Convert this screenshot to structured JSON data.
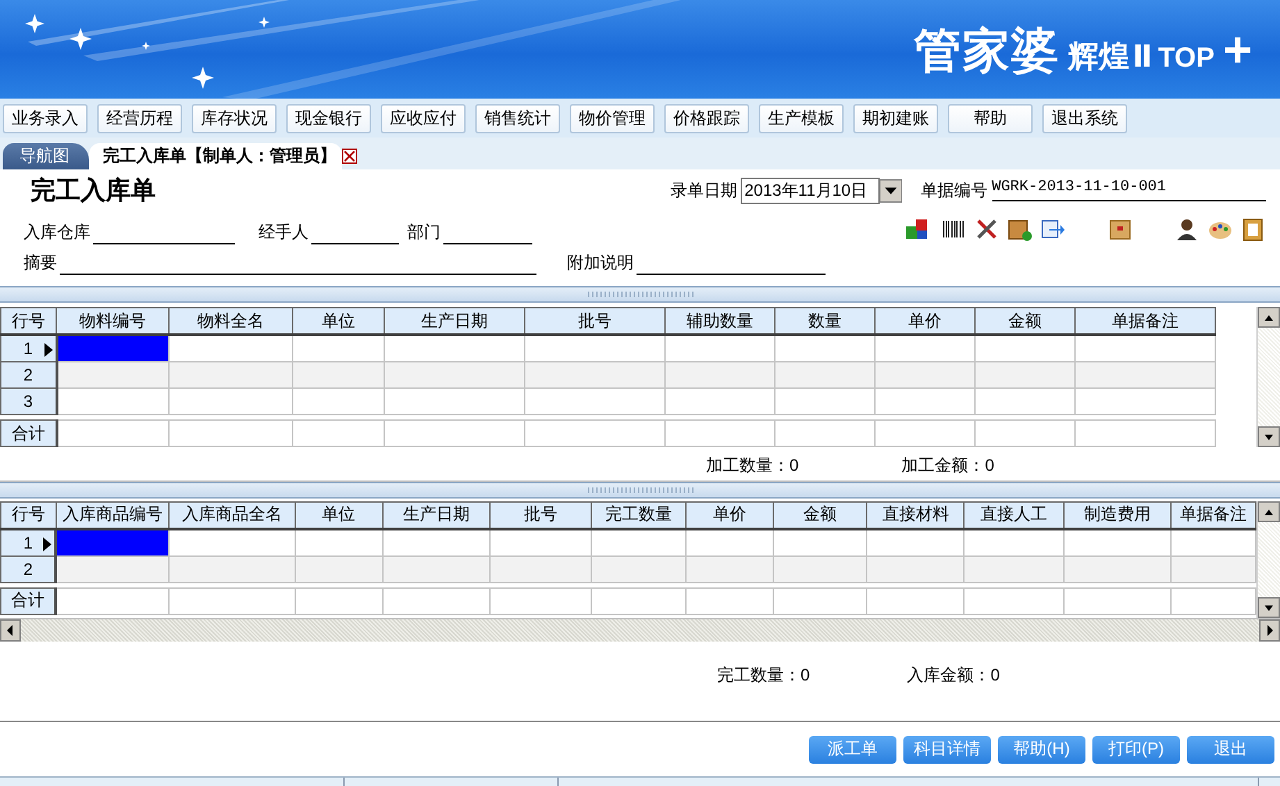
{
  "banner": {
    "brand": "管家婆",
    "product": "辉煌",
    "edition": "Ⅱ",
    "suffix": "TOP",
    "plus": "+"
  },
  "menu": [
    {
      "label": "业务录入"
    },
    {
      "label": "经营历程"
    },
    {
      "label": "库存状况"
    },
    {
      "label": "现金银行"
    },
    {
      "label": "应收应付"
    },
    {
      "label": "销售统计"
    },
    {
      "label": "物价管理"
    },
    {
      "label": "价格跟踪"
    },
    {
      "label": "生产模板"
    },
    {
      "label": "期初建账"
    },
    {
      "label": "帮助"
    },
    {
      "label": "退出系统"
    }
  ],
  "nav": {
    "home_tab": "导航图",
    "document_tab": "完工入库单【制单人：管理员】"
  },
  "form": {
    "title": "完工入库单",
    "date_label": "录单日期",
    "date_value": "2013年11月10日",
    "number_label": "单据编号",
    "number_value": "WGRK-2013-11-10-001",
    "fields": [
      {
        "label": "入库仓库"
      },
      {
        "label": "经手人"
      },
      {
        "label": "部门"
      },
      {
        "label": "摘要"
      },
      {
        "label": "附加说明"
      }
    ]
  },
  "material_grid": {
    "columns": [
      "行号",
      "物料编号",
      "物料全名",
      "单位",
      "生产日期",
      "批号",
      "辅助数量",
      "数量",
      "单价",
      "金额",
      "单据备注"
    ],
    "rows": [
      {
        "row_number": "1",
        "selected": true
      },
      {
        "row_number": "2",
        "selected": false
      },
      {
        "row_number": "3",
        "selected": false
      }
    ],
    "total_label": "合计"
  },
  "material_summary": [
    "加工数量：0",
    "加工金额：0"
  ],
  "product_grid": {
    "columns": [
      "行号",
      "入库商品编号",
      "入库商品全名",
      "单位",
      "生产日期",
      "批号",
      "完工数量",
      "单价",
      "金额",
      "直接材料",
      "直接人工",
      "制造费用",
      "单据备注"
    ],
    "rows": [
      {
        "row_number": "1",
        "selected": true
      },
      {
        "row_number": "2",
        "selected": false
      }
    ],
    "total_label": "合计"
  },
  "product_summary": [
    "完工数量：0",
    "入库金额：0"
  ],
  "buttons": [
    "派工单",
    "科目详情",
    "帮助(H)",
    "打印(P)",
    "退出"
  ]
}
